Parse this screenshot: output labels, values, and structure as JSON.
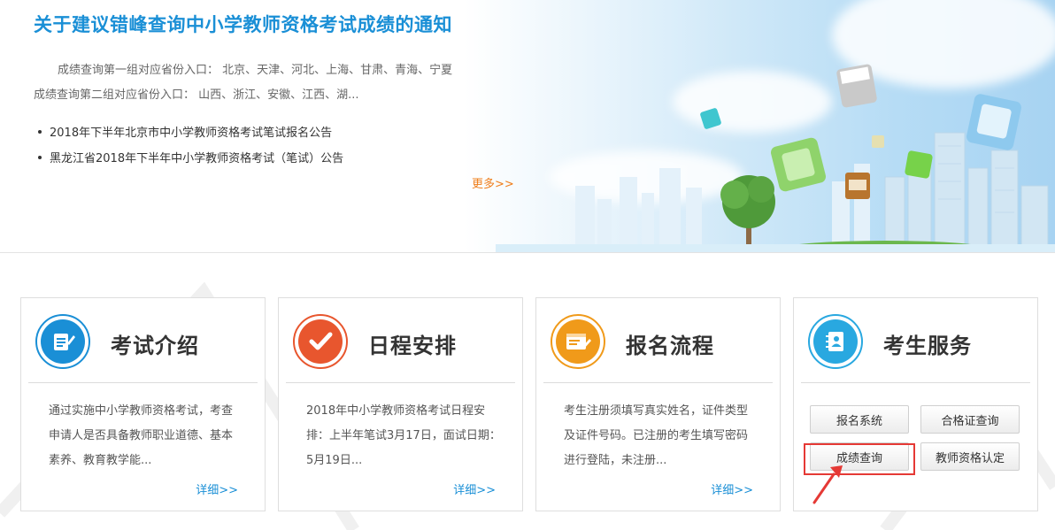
{
  "notice": {
    "title": "关于建议错峰查询中小学教师资格考试成绩的通知",
    "desc_line1": "成绩查询第一组对应省份入口： 北京、天津、河北、上海、甘肃、青海、宁夏",
    "desc_line2": "成绩查询第二组对应省份入口： 山西、浙江、安徽、江西、湖..."
  },
  "news": [
    "2018年下半年北京市中小学教师资格考试笔试报名公告",
    "黑龙江省2018年下半年中小学教师资格考试（笔试）公告"
  ],
  "more_label": "更多>>",
  "cards": [
    {
      "title": "考试介绍",
      "icon": "document-pen-icon",
      "color": "#1a8fd6",
      "desc": "通过实施中小学教师资格考试，考查申请人是否具备教师职业道德、基本素养、教育教学能...",
      "detail": "详细>>"
    },
    {
      "title": "日程安排",
      "icon": "checkmark-icon",
      "color": "#e8562e",
      "desc": "2018年中小学教师资格考试日程安排：上半年笔试3月17日，面试日期：5月19日...",
      "detail": "详细>>"
    },
    {
      "title": "报名流程",
      "icon": "form-edit-icon",
      "color": "#f09a1a",
      "desc": "考生注册须填写真实姓名，证件类型及证件号码。已注册的考生填写密码进行登陆，未注册...",
      "detail": "详细>>"
    },
    {
      "title": "考生服务",
      "icon": "contact-book-icon",
      "color": "#29a8e0"
    }
  ],
  "services": {
    "register": "报名系统",
    "certificate": "合格证查询",
    "score": "成绩查询",
    "qualification": "教师资格认定"
  },
  "colors": {
    "title_blue": "#1a8fd6",
    "more_orange": "#ef7d1a",
    "highlight_red": "#e53935"
  }
}
